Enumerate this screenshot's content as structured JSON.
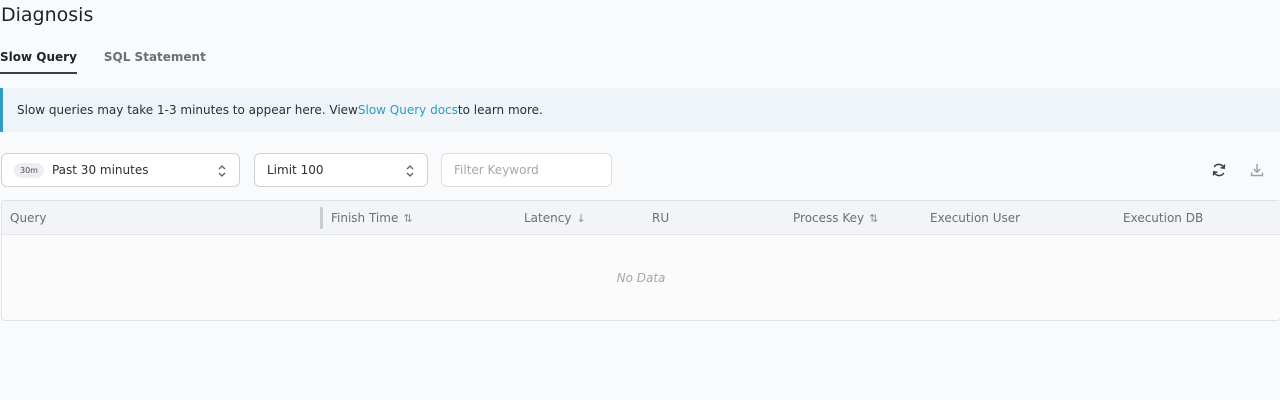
{
  "page": {
    "title": "Diagnosis"
  },
  "tabs": [
    {
      "label": "Slow Query",
      "active": true
    },
    {
      "label": "SQL Statement",
      "active": false
    }
  ],
  "banner": {
    "text_before": "Slow queries may take 1-3 minutes to appear here. View ",
    "link_text": "Slow Query docs",
    "text_after": " to learn more."
  },
  "toolbar": {
    "time_range": {
      "badge": "30m",
      "value": "Past 30 minutes"
    },
    "limit": {
      "value": "Limit 100"
    },
    "filter": {
      "placeholder": "Filter Keyword",
      "value": ""
    },
    "refresh_icon": "refresh-icon",
    "download_icon": "download-icon"
  },
  "table": {
    "columns": [
      {
        "label": "Query",
        "sort": ""
      },
      {
        "label": "Finish Time",
        "sort": "⇅"
      },
      {
        "label": "Latency",
        "sort": "↓"
      },
      {
        "label": "RU",
        "sort": ""
      },
      {
        "label": "Process Key",
        "sort": "⇅"
      },
      {
        "label": "Execution User",
        "sort": ""
      },
      {
        "label": "Execution DB",
        "sort": ""
      }
    ],
    "empty_text": "No Data"
  },
  "colors": {
    "accent": "#2f9bc7",
    "banner_bg": "#eef4f8",
    "page_bg": "#f9fafc"
  }
}
